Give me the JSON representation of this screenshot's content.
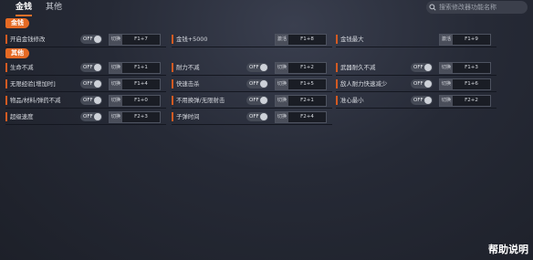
{
  "tabs": [
    {
      "label": "金钱",
      "active": true
    },
    {
      "label": "其他",
      "active": false
    }
  ],
  "search": {
    "placeholder": "搜索修改器功能名称",
    "value": ""
  },
  "sections": [
    {
      "title": "金钱",
      "rows": [
        [
          {
            "label": "开启金钱修改",
            "toggle": "OFF",
            "mode": "切换",
            "key": "F1+7"
          },
          {
            "label": "金钱+5000",
            "toggle": null,
            "mode": "激活",
            "key": "F1+8"
          },
          {
            "label": "金钱最大",
            "toggle": null,
            "mode": "激活",
            "key": "F1+9"
          }
        ]
      ]
    },
    {
      "title": "其他",
      "rows": [
        [
          {
            "label": "生命不减",
            "toggle": "OFF",
            "mode": "切换",
            "key": "F1+1"
          },
          {
            "label": "耐力不减",
            "toggle": "OFF",
            "mode": "切换",
            "key": "F1+2"
          },
          {
            "label": "武器耐久不减",
            "toggle": "OFF",
            "mode": "切换",
            "key": "F1+3"
          }
        ],
        [
          {
            "label": "无限经验[增加时]",
            "toggle": "OFF",
            "mode": "切换",
            "key": "F1+4"
          },
          {
            "label": "快速击杀",
            "toggle": "OFF",
            "mode": "切换",
            "key": "F1+5"
          },
          {
            "label": "敌人耐力快速减少",
            "toggle": "OFF",
            "mode": "切换",
            "key": "F1+6"
          }
        ],
        [
          {
            "label": "物品/材料/弹药不减",
            "toggle": "OFF",
            "mode": "切换",
            "key": "F1+0"
          },
          {
            "label": "不用换弹/无限射击",
            "toggle": "OFF",
            "mode": "切换",
            "key": "F2+1"
          },
          {
            "label": "准心最小",
            "toggle": "OFF",
            "mode": "切换",
            "key": "F2+2"
          }
        ],
        [
          {
            "label": "超级速度",
            "toggle": "OFF",
            "mode": "切换",
            "key": "F2+3"
          },
          {
            "label": "子弹时间",
            "toggle": "OFF",
            "mode": "切换",
            "key": "F2+4"
          }
        ]
      ]
    }
  ],
  "help_label": "帮助说明",
  "colors": {
    "accent": "#e56a24",
    "background": "#262a36"
  }
}
